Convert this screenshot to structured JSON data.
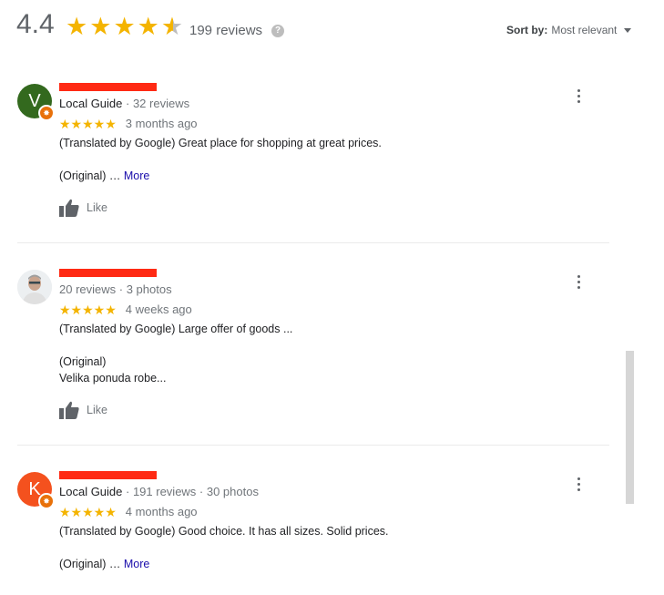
{
  "header": {
    "rating": "4.4",
    "rating_stars": 4.4,
    "review_count": "199 reviews",
    "help_icon": "?",
    "sort_label": "Sort by:",
    "sort_value": "Most relevant"
  },
  "reviews": [
    {
      "avatar_letter": "V",
      "avatar_color": "#33691e",
      "is_local_guide": true,
      "guide_label": "Local Guide",
      "meta": " · 32 reviews",
      "stars": "★★★★★",
      "ago": "3 months ago",
      "text_line1": "(Translated by Google) Great place for shopping at great prices.",
      "original": "(Original) … ",
      "more": "More",
      "like": "Like"
    },
    {
      "avatar_letter": "",
      "avatar_color": "#e8eaed",
      "is_local_guide": false,
      "meta": "20 reviews · 3 photos",
      "stars": "★★★★★",
      "ago": "4 weeks ago",
      "text_line1": "(Translated by Google) Large offer of goods ...",
      "original": "(Original)",
      "original_text": "Velika ponuda robe...",
      "like": "Like"
    },
    {
      "avatar_letter": "K",
      "avatar_color": "#f4511e",
      "is_local_guide": true,
      "guide_label": "Local Guide",
      "meta": " · 191 reviews · 30 photos",
      "stars": "★★★★★",
      "ago": "4 months ago",
      "text_line1": "(Translated by Google) Good choice. It has all sizes. Solid prices.",
      "original": "(Original) … ",
      "more": "More"
    }
  ]
}
